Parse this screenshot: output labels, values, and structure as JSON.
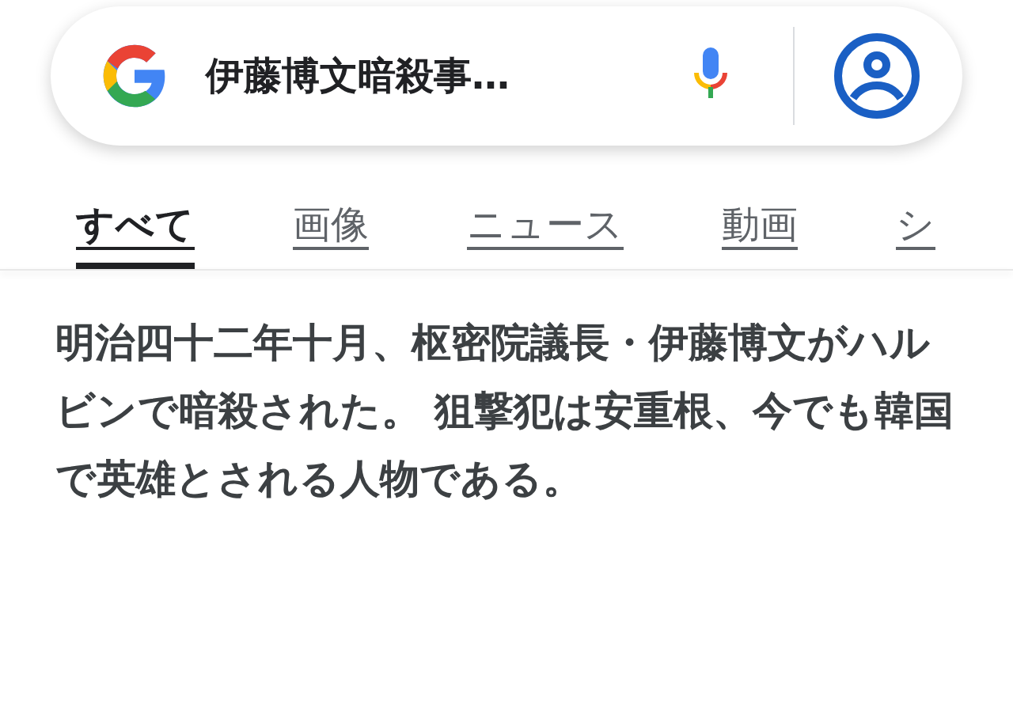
{
  "search": {
    "query": "伊藤博文暗殺事…"
  },
  "tabs": [
    {
      "label": "すべて",
      "selected": true
    },
    {
      "label": "画像",
      "selected": false
    },
    {
      "label": "ニュース",
      "selected": false
    },
    {
      "label": "動画",
      "selected": false
    },
    {
      "label": "シ",
      "selected": false
    }
  ],
  "result": {
    "text": "明治四十二年十月、枢密院議長・伊藤博文がハルビンで暗殺された。 狙撃犯は安重根、今でも韓国で英雄とされる人物である。"
  }
}
